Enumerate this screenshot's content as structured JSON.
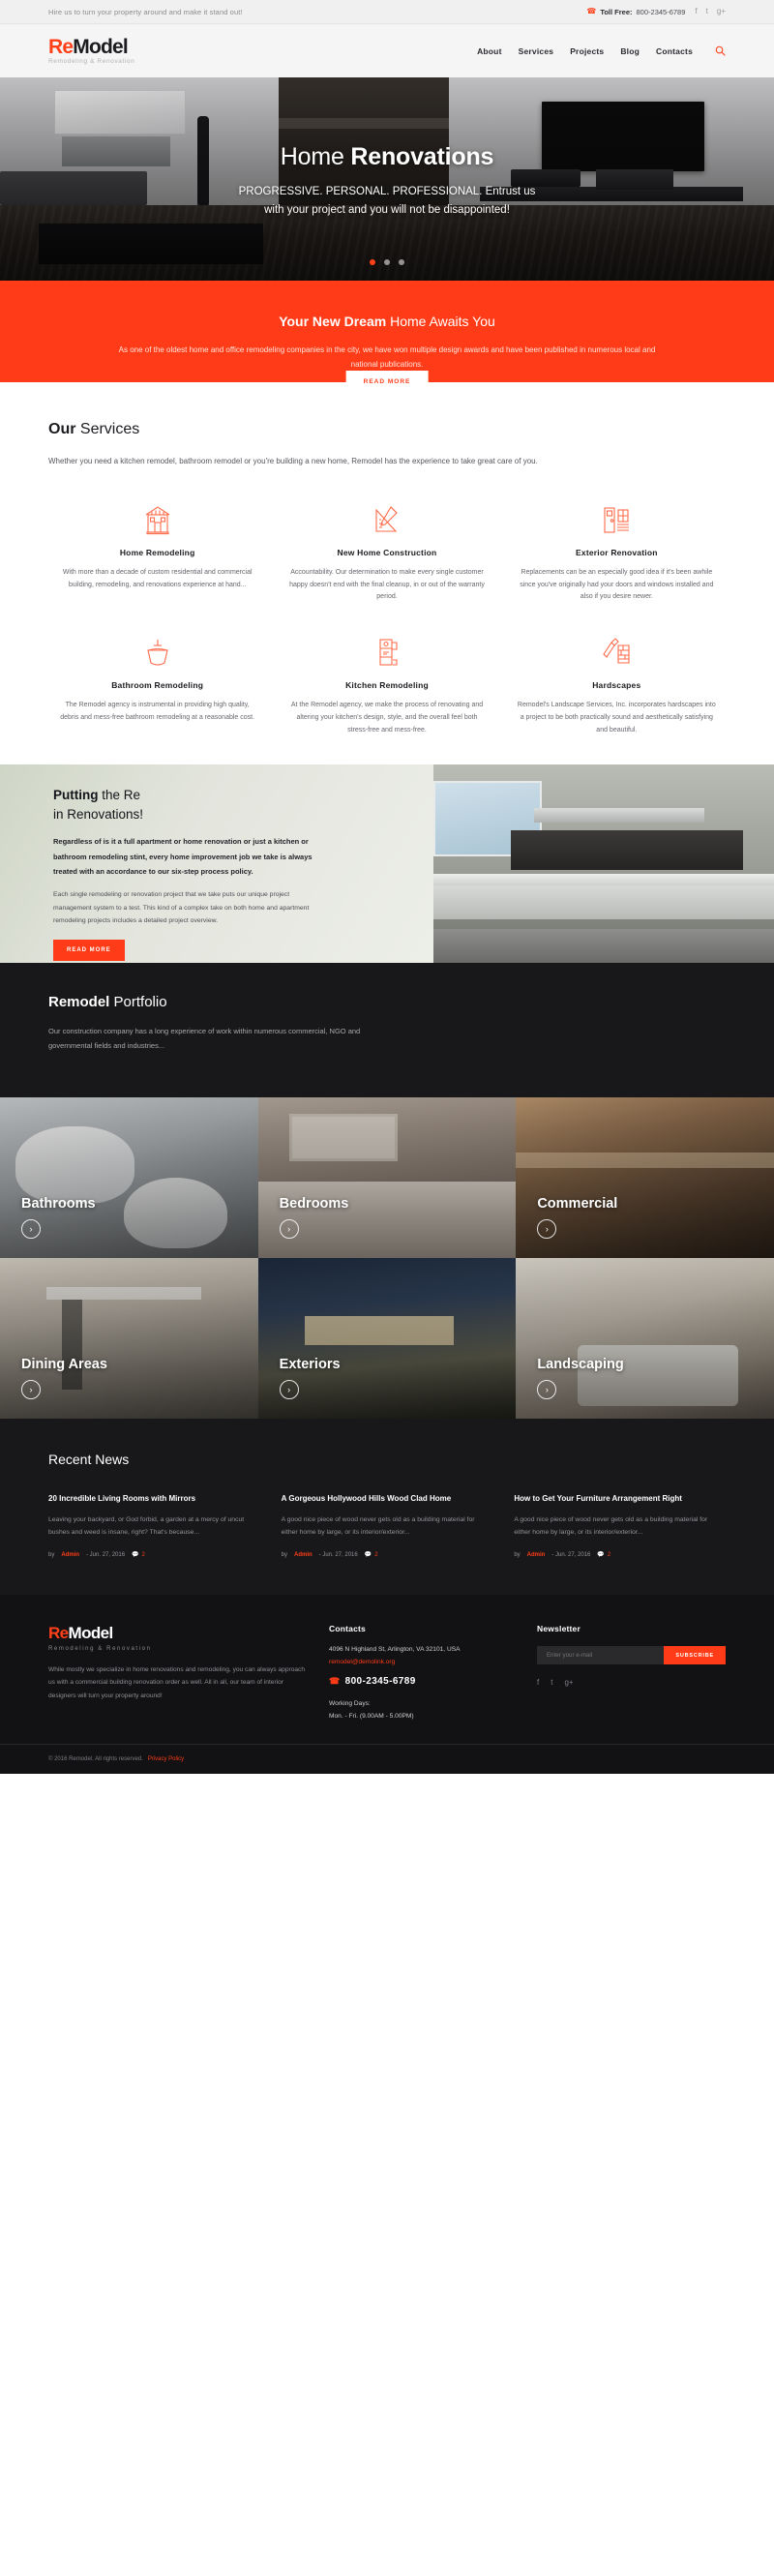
{
  "topbar": {
    "slogan": "Hire us to turn your property around and make it stand out!",
    "toll_label": "Toll Free:",
    "toll_number": "800-2345-6789",
    "social": [
      "f",
      "t",
      "g+"
    ]
  },
  "header": {
    "brand_pre": "Re",
    "brand_post": "M",
    "brand_mid": "o",
    "brand_end": "del",
    "brand_full_a": "Re",
    "brand_full_b": "Model",
    "brand_tagline": "Remodeling & Renovation",
    "nav": [
      {
        "label": "About"
      },
      {
        "label": "Services"
      },
      {
        "label": "Projects"
      },
      {
        "label": "Blog"
      },
      {
        "label": "Contacts"
      }
    ],
    "search_icon": "search-icon"
  },
  "hero": {
    "title_light": "Home",
    "title_bold": "Renovations",
    "subtitle_line1": "PROGRESSIVE. PERSONAL. PROFESSIONAL. Entrust us",
    "subtitle_line2": "with your project and you will not be disappointed!",
    "dots": [
      {
        "active": true
      },
      {
        "active": false
      },
      {
        "active": false
      }
    ]
  },
  "cta": {
    "title_bold": "Your New Dream",
    "title_light": "Home Awaits You",
    "text": "As one of the oldest home and office remodeling companies in the city, we have won multiple design awards and have been published in numerous local and national publications.",
    "button": "READ MORE"
  },
  "services": {
    "title_bold": "Our",
    "title_light": "Services",
    "lead": "Whether you need a kitchen remodel, bathroom remodel or you're building a new home, Remodel has the experience to take great care of you.",
    "items": [
      {
        "icon": "house-icon",
        "name": "Home Remodeling",
        "desc": "With more than a decade of custom residential and commercial building, remodeling, and renovations experience at hand..."
      },
      {
        "icon": "ruler-pencil-icon",
        "name": "New Home Construction",
        "desc": "Accountability. Our determination to make every single customer happy doesn't end with the final cleanup, in or out of the warranty period."
      },
      {
        "icon": "door-window-icon",
        "name": "Exterior Renovation",
        "desc": "Replacements can be an especially good idea if it's been awhile since you've originally had your doors and windows installed and also if you desire newer."
      },
      {
        "icon": "sink-icon",
        "name": "Bathroom Remodeling",
        "desc": "The Remodel agency is instrumental in providing high quality, debris and mess-free bathroom remodeling at a reasonable cost."
      },
      {
        "icon": "blender-icon",
        "name": "Kitchen Remodeling",
        "desc": "At the Remodel agency, we make the process of renovating and altering your kitchen's design, style, and the overall feel both stress-free and mess-free."
      },
      {
        "icon": "trowel-bricks-icon",
        "name": "Hardscapes",
        "desc": "Remodel's Landscape Services, Inc. incorporates hardscapes into a project to be both practically sound and aesthetically satisfying and beautiful."
      }
    ]
  },
  "putting": {
    "title_bold": "Putting",
    "title_light_1": "the Re",
    "title_light_2": "in Renovations!",
    "strong": "Regardless of is it a full apartment or home renovation or just a kitchen or bathroom remodeling stint, every home improvement job we take is always treated with an accordance to our six-step process policy.",
    "body": "Each single remodeling or renovation project that we take puts our unique project management system to a test. This kind of a complex take on both home and apartment remodeling projects includes a detailed project overview.",
    "button": "READ MORE"
  },
  "portfolio": {
    "title_bold": "Remodel",
    "title_light": "Portfolio",
    "lead": "Our construction company has a long experience of work within numerous commercial, NGO and governmental fields and industries...",
    "items": [
      {
        "label": "Bathrooms",
        "img": "img-bathrooms",
        "arrow": "›"
      },
      {
        "label": "Bedrooms",
        "img": "img-bedrooms",
        "arrow": "›"
      },
      {
        "label": "Commercial",
        "img": "img-commercial",
        "arrow": "›"
      },
      {
        "label": "Dining Areas",
        "img": "img-dining",
        "arrow": "›"
      },
      {
        "label": "Exteriors",
        "img": "img-exteriors",
        "arrow": "›"
      },
      {
        "label": "Landscaping",
        "img": "img-landscaping",
        "arrow": "›"
      }
    ]
  },
  "news": {
    "title": "Recent News",
    "items": [
      {
        "heading": "20 Incredible Living Rooms with Mirrors",
        "excerpt": "Leaving your backyard, or God forbid, a garden at a mercy of uncut bushes and weed is insane, right? That's because...",
        "by": "by",
        "author": "Admin",
        "date": "- Jun. 27, 2016",
        "comments": "2"
      },
      {
        "heading": "A Gorgeous Hollywood Hills Wood Clad Home",
        "excerpt": "A good nice piece of wood never gets old as a building material for either home by large, or its interior/exterior...",
        "by": "by",
        "author": "Admin",
        "date": "- Jun. 27, 2016",
        "comments": "2"
      },
      {
        "heading": "How to Get Your Furniture Arrangement Right",
        "excerpt": "A good nice piece of wood never gets old as a building material for either home by large, or its interior/exterior...",
        "by": "by",
        "author": "Admin",
        "date": "- Jun. 27, 2016",
        "comments": "2"
      }
    ]
  },
  "footer": {
    "brand_a": "Re",
    "brand_b": "Model",
    "brand_tagline": "Remodeling & Renovation",
    "about": "While mostly we specialize in home renovations and remodeling, you can always approach us with a commercial building renovation order as well. All in all, our team of interior designers will turn your property around!",
    "contacts_head": "Contacts",
    "address": "4096 N Highland St, Arlington, VA 32101, USA",
    "email": "remodel@demolink.org",
    "phone": "800-2345-6789",
    "working_days_label": "Working Days:",
    "working_days_value": "Mon. - Fri. (9.00AM - 5.00PM)",
    "newsletter_head": "Newsletter",
    "newsletter_placeholder": "Enter your e-mail",
    "subscribe_button": "SUBSCRIBE",
    "social": [
      "f",
      "t",
      "g+"
    ]
  },
  "copyright": {
    "text": "© 2016 Remodel. All rights reserved.",
    "link": "Privacy Policy"
  },
  "colors": {
    "accent": "#ff3c17",
    "dark": "#18181a",
    "darker": "#121214"
  }
}
